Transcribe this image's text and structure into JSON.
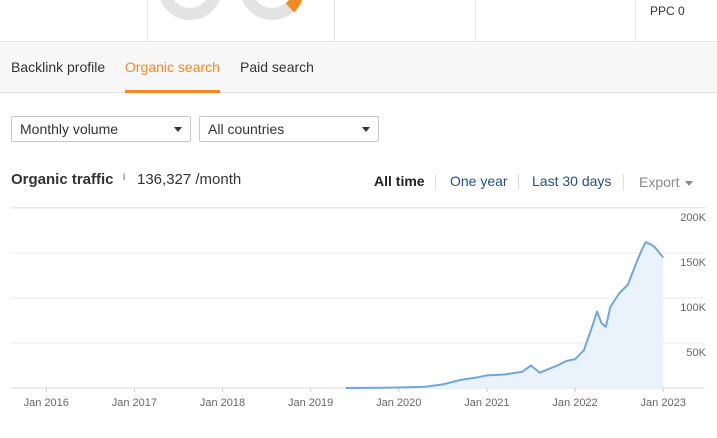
{
  "top": {
    "ppc_label": "PPC 0"
  },
  "tabs": [
    {
      "label": "Backlink profile",
      "active": false
    },
    {
      "label": "Organic search",
      "active": true
    },
    {
      "label": "Paid search",
      "active": false
    }
  ],
  "filters": {
    "volume": "Monthly volume",
    "countries": "All countries"
  },
  "header": {
    "title": "Organic traffic",
    "info_marker": "i",
    "value": "136,327 /month"
  },
  "ranges": {
    "all_time": "All time",
    "one_year": "One year",
    "last_30": "Last 30 days",
    "export": "Export"
  },
  "colors": {
    "accent": "#f28a1e",
    "link": "#1e4f8a",
    "line": "#6fa8d8",
    "area": "#eaf2fb"
  },
  "chart_data": {
    "type": "area",
    "xlabel": "",
    "ylabel": "",
    "x_ticks": [
      "Jan 2016",
      "Jan 2017",
      "Jan 2018",
      "Jan 2019",
      "Jan 2020",
      "Jan 2021",
      "Jan 2022",
      "Jan 2023"
    ],
    "y_ticks": [
      "50K",
      "100K",
      "150K",
      "200K"
    ],
    "ylim": [
      0,
      200000
    ],
    "xlim": [
      2015.6,
      2023.1
    ],
    "grid": true,
    "series": [
      {
        "x": [
          2019.4,
          2019.8,
          2020.0,
          2020.3,
          2020.5,
          2020.7,
          2020.9,
          2021.0,
          2021.2,
          2021.4,
          2021.5,
          2021.6,
          2021.7,
          2021.8,
          2021.9,
          2022.0,
          2022.1,
          2022.2,
          2022.25,
          2022.3,
          2022.35,
          2022.4,
          2022.5,
          2022.6,
          2022.7,
          2022.75,
          2022.8,
          2022.85,
          2022.9,
          2023.0
        ],
        "y": [
          0,
          300,
          600,
          1500,
          4000,
          9000,
          12000,
          14000,
          15000,
          18000,
          25000,
          17000,
          21000,
          25000,
          30000,
          32000,
          42000,
          70000,
          85000,
          72000,
          68000,
          90000,
          105000,
          115000,
          140000,
          152000,
          162000,
          160000,
          157000,
          145000
        ]
      }
    ]
  }
}
